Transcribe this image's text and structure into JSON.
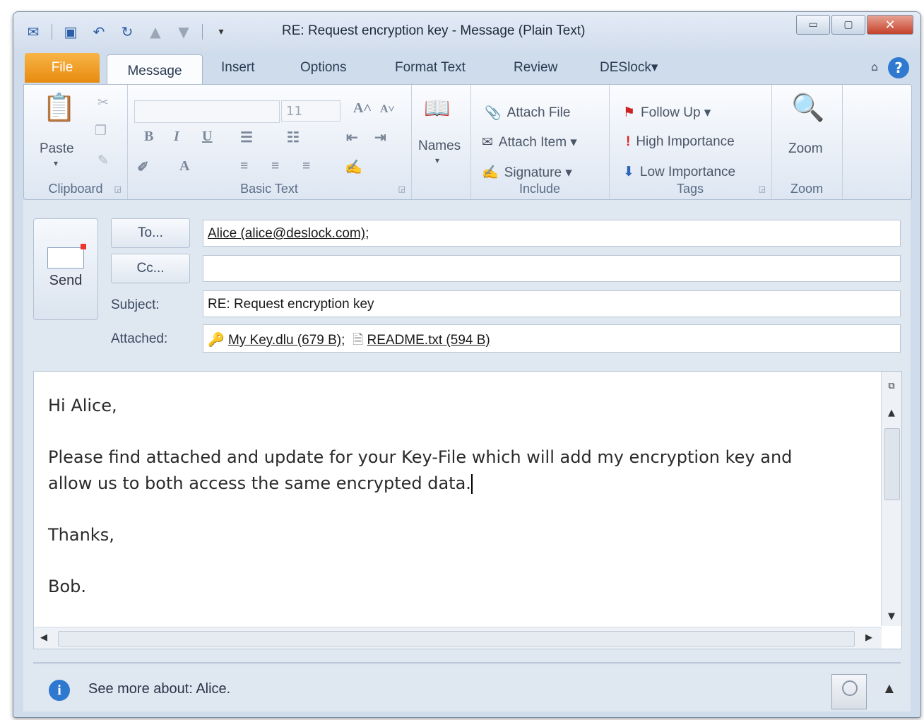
{
  "window": {
    "title": "RE: Request encryption key  - Message (Plain Text)",
    "controls": {
      "minimize": "▭",
      "maximize": "▢",
      "close": "✕"
    }
  },
  "qat": {
    "icons": [
      "outlook-icon",
      "save-icon",
      "undo-icon",
      "redo-icon",
      "up-icon",
      "down-icon",
      "customize-icon"
    ]
  },
  "tabs": [
    "File",
    "Message",
    "Insert",
    "Options",
    "Format Text",
    "Review",
    "DESlock▾"
  ],
  "ribbon": {
    "clipboard": {
      "label": "Clipboard",
      "paste": "Paste"
    },
    "basic_text": {
      "label": "Basic Text",
      "font_size": "11",
      "bold": "B",
      "italic": "I",
      "underline": "U"
    },
    "names": {
      "label": "Names"
    },
    "include": {
      "label": "Include",
      "attach_file": "Attach File",
      "attach_item": "Attach Item ▾",
      "signature": "Signature ▾"
    },
    "tags": {
      "label": "Tags",
      "follow_up": "Follow Up ▾",
      "high": "High Importance",
      "low": "Low Importance"
    },
    "zoom": {
      "label": "Zoom",
      "button": "Zoom"
    }
  },
  "compose": {
    "send": "Send",
    "to_button": "To...",
    "cc_button": "Cc...",
    "to_value": "Alice (alice@deslock.com);",
    "cc_value": "",
    "subject_label": "Subject:",
    "subject_value": "RE: Request encryption key",
    "attached_label": "Attached:",
    "attachments": [
      "My Key.dlu (679 B);",
      "README.txt (594 B)"
    ]
  },
  "body": {
    "greeting": "Hi Alice,",
    "line1": "Please find attached and update for your Key-File which will add my encryption key and",
    "line2": "allow us to both access the same encrypted data.",
    "closing": "Thanks,",
    "signature": "Bob."
  },
  "people_pane": {
    "text": "See more about: Alice."
  }
}
